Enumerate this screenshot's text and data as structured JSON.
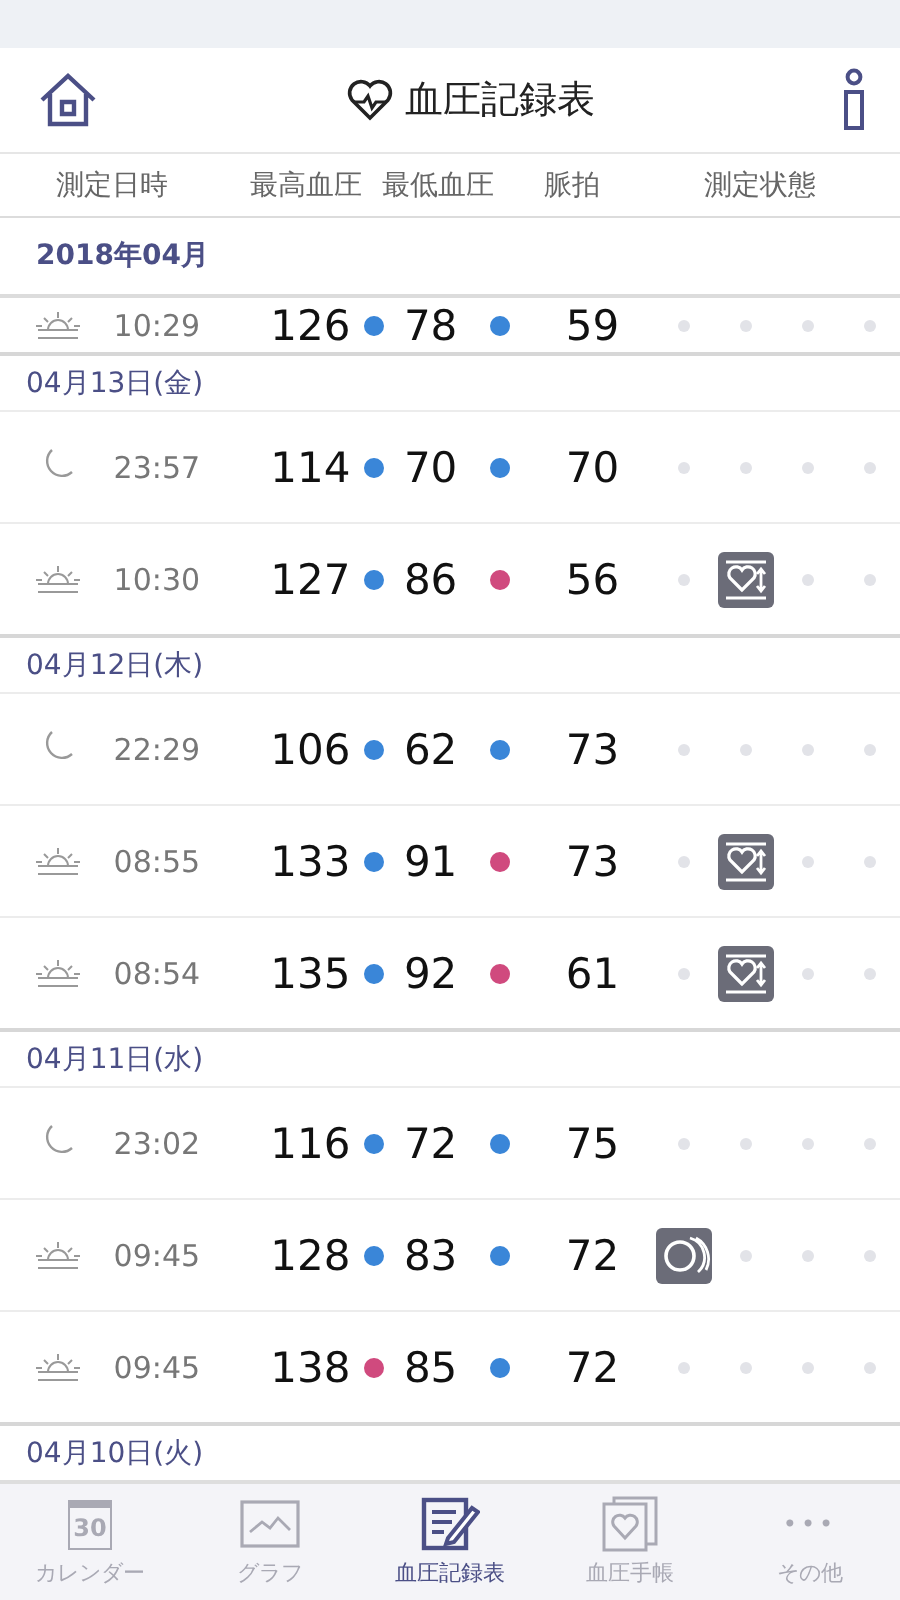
{
  "header": {
    "title": "血圧記録表"
  },
  "columns": [
    "測定日時",
    "最高血圧",
    "最低血圧",
    "脈拍",
    "測定状態"
  ],
  "month": "2018年04月",
  "groups": [
    {
      "records": [
        {
          "kind": "morning",
          "time": "10:29",
          "systolic": {
            "value": "126",
            "color": "#3a86d8"
          },
          "diastolic": {
            "value": "78",
            "color": "#3a86d8"
          },
          "pulse": "59",
          "status": [
            {
              "kind": "empty"
            },
            {
              "kind": "empty"
            },
            {
              "kind": "empty"
            },
            {
              "kind": "empty"
            }
          ]
        }
      ]
    },
    {
      "date": "04月13日(金)",
      "records": [
        {
          "kind": "night",
          "time": "23:57",
          "systolic": {
            "value": "114",
            "color": "#3a86d8"
          },
          "diastolic": {
            "value": "70",
            "color": "#3a86d8"
          },
          "pulse": "70",
          "status": [
            {
              "kind": "empty"
            },
            {
              "kind": "empty"
            },
            {
              "kind": "empty"
            },
            {
              "kind": "empty"
            }
          ]
        },
        {
          "kind": "morning",
          "time": "10:30",
          "systolic": {
            "value": "127",
            "color": "#3a86d8"
          },
          "diastolic": {
            "value": "86",
            "color": "#d04a7e"
          },
          "pulse": "56",
          "status": [
            {
              "kind": "empty"
            },
            {
              "kind": "movement"
            },
            {
              "kind": "empty"
            },
            {
              "kind": "empty"
            }
          ]
        }
      ]
    },
    {
      "date": "04月12日(木)",
      "records": [
        {
          "kind": "night",
          "time": "22:29",
          "systolic": {
            "value": "106",
            "color": "#3a86d8"
          },
          "diastolic": {
            "value": "62",
            "color": "#3a86d8"
          },
          "pulse": "73",
          "status": [
            {
              "kind": "empty"
            },
            {
              "kind": "empty"
            },
            {
              "kind": "empty"
            },
            {
              "kind": "empty"
            }
          ]
        },
        {
          "kind": "morning",
          "time": "08:55",
          "systolic": {
            "value": "133",
            "color": "#3a86d8"
          },
          "diastolic": {
            "value": "91",
            "color": "#d04a7e"
          },
          "pulse": "73",
          "status": [
            {
              "kind": "empty"
            },
            {
              "kind": "movement"
            },
            {
              "kind": "empty"
            },
            {
              "kind": "empty"
            }
          ]
        },
        {
          "kind": "morning",
          "time": "08:54",
          "systolic": {
            "value": "135",
            "color": "#3a86d8"
          },
          "diastolic": {
            "value": "92",
            "color": "#d04a7e"
          },
          "pulse": "61",
          "status": [
            {
              "kind": "empty"
            },
            {
              "kind": "movement"
            },
            {
              "kind": "empty"
            },
            {
              "kind": "empty"
            }
          ]
        }
      ]
    },
    {
      "date": "04月11日(水)",
      "records": [
        {
          "kind": "night",
          "time": "23:02",
          "systolic": {
            "value": "116",
            "color": "#3a86d8"
          },
          "diastolic": {
            "value": "72",
            "color": "#3a86d8"
          },
          "pulse": "75",
          "status": [
            {
              "kind": "empty"
            },
            {
              "kind": "empty"
            },
            {
              "kind": "empty"
            },
            {
              "kind": "empty"
            }
          ]
        },
        {
          "kind": "morning",
          "time": "09:45",
          "systolic": {
            "value": "128",
            "color": "#3a86d8"
          },
          "diastolic": {
            "value": "83",
            "color": "#3a86d8"
          },
          "pulse": "72",
          "status": [
            {
              "kind": "cuff"
            },
            {
              "kind": "empty"
            },
            {
              "kind": "empty"
            },
            {
              "kind": "empty"
            }
          ]
        },
        {
          "kind": "morning",
          "time": "09:45",
          "systolic": {
            "value": "138",
            "color": "#d04a7e"
          },
          "diastolic": {
            "value": "85",
            "color": "#3a86d8"
          },
          "pulse": "72",
          "status": [
            {
              "kind": "empty"
            },
            {
              "kind": "empty"
            },
            {
              "kind": "empty"
            },
            {
              "kind": "empty"
            }
          ]
        }
      ]
    },
    {
      "date": "04月10日(火)"
    }
  ],
  "tabs": [
    {
      "kind": "calendar",
      "label": "カレンダー",
      "icon_text": "30",
      "selected": false
    },
    {
      "kind": "graph",
      "label": "グラフ",
      "selected": false
    },
    {
      "kind": "record",
      "label": "血圧記録表",
      "selected": true
    },
    {
      "kind": "notebook",
      "label": "血圧手帳",
      "selected": false
    },
    {
      "kind": "more",
      "label": "その他",
      "icon_text": "•••",
      "selected": false
    }
  ]
}
